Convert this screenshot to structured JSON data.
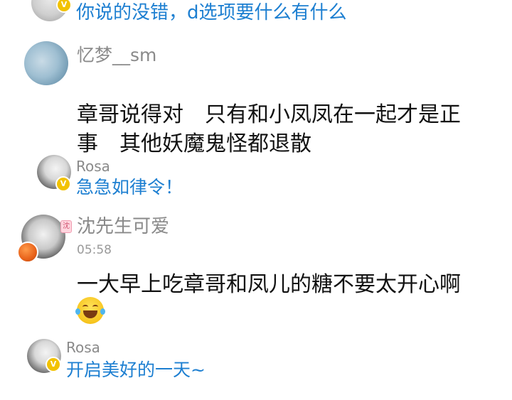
{
  "top_reply": {
    "text": "你说的没错，d选项要什么有什么",
    "badge": "V"
  },
  "comment_meng": {
    "username": "忆梦__sm",
    "line1": "章哥说得对　只有和小凤凤在一起才是正",
    "line2": "事　其他妖魔鬼怪都退散"
  },
  "reply_rosa_1": {
    "username": "Rosa",
    "text": "急急如律令！",
    "badge": "V"
  },
  "comment_shen": {
    "username": "沈先生可爱",
    "time": "05:58",
    "text": "一大早上吃章哥和凤儿的糖不要太开心啊",
    "sticker": "沈",
    "emoji": "laughing-tears-emoji"
  },
  "reply_rosa_2": {
    "username": "Rosa",
    "text": "开启美好的一天~",
    "badge": "V"
  },
  "colors": {
    "blue": "#1d7fd1",
    "gray": "#8a8a8a",
    "black": "#111111",
    "badge_gold": "#f2c200"
  }
}
